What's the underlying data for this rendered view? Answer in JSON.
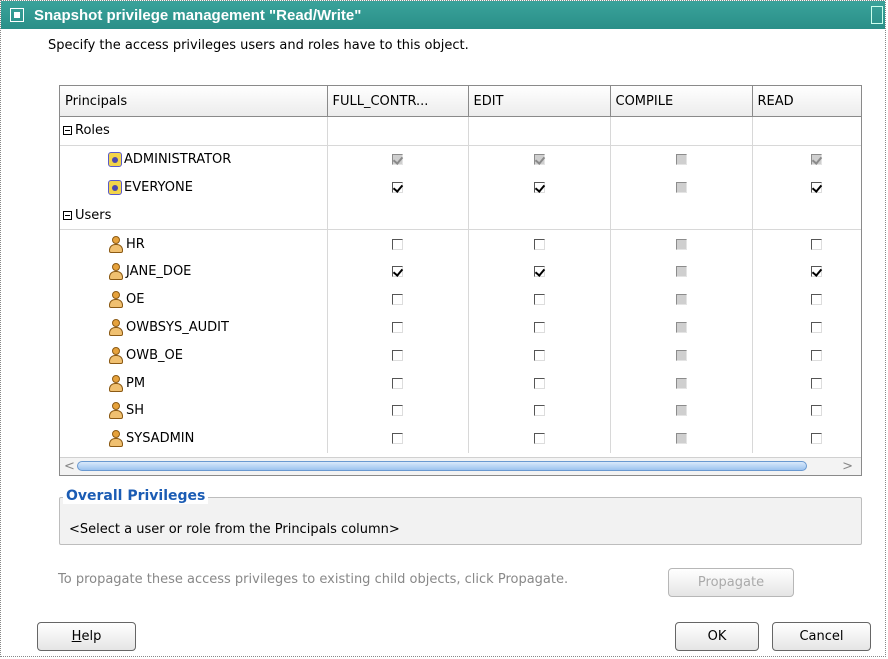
{
  "dialog": {
    "title": "Snapshot privilege management \"Read/Write\"",
    "instructions": "Specify the access privileges users and roles have to this object."
  },
  "table": {
    "columns": [
      "Principals",
      "FULL_CONTR...",
      "EDIT",
      "COMPILE",
      "READ"
    ],
    "groups": [
      {
        "label": "Roles",
        "type": "role",
        "rows": [
          {
            "name": "ADMINISTRATOR",
            "full_control": {
              "checked": true,
              "enabled": false
            },
            "edit": {
              "checked": true,
              "enabled": false
            },
            "compile": {
              "checked": false,
              "enabled": false
            },
            "read": {
              "checked": true,
              "enabled": false
            }
          },
          {
            "name": "EVERYONE",
            "full_control": {
              "checked": true,
              "enabled": true
            },
            "edit": {
              "checked": true,
              "enabled": true
            },
            "compile": {
              "checked": false,
              "enabled": false
            },
            "read": {
              "checked": true,
              "enabled": true
            }
          }
        ]
      },
      {
        "label": "Users",
        "type": "user",
        "rows": [
          {
            "name": "HR",
            "full_control": {
              "checked": false,
              "enabled": true
            },
            "edit": {
              "checked": false,
              "enabled": true
            },
            "compile": {
              "checked": false,
              "enabled": false
            },
            "read": {
              "checked": false,
              "enabled": true
            }
          },
          {
            "name": "JANE_DOE",
            "full_control": {
              "checked": true,
              "enabled": true
            },
            "edit": {
              "checked": true,
              "enabled": true
            },
            "compile": {
              "checked": false,
              "enabled": false
            },
            "read": {
              "checked": true,
              "enabled": true
            }
          },
          {
            "name": "OE",
            "full_control": {
              "checked": false,
              "enabled": true
            },
            "edit": {
              "checked": false,
              "enabled": true
            },
            "compile": {
              "checked": false,
              "enabled": false
            },
            "read": {
              "checked": false,
              "enabled": true
            }
          },
          {
            "name": "OWBSYS_AUDIT",
            "full_control": {
              "checked": false,
              "enabled": true
            },
            "edit": {
              "checked": false,
              "enabled": true
            },
            "compile": {
              "checked": false,
              "enabled": false
            },
            "read": {
              "checked": false,
              "enabled": true
            }
          },
          {
            "name": "OWB_OE",
            "full_control": {
              "checked": false,
              "enabled": true
            },
            "edit": {
              "checked": false,
              "enabled": true
            },
            "compile": {
              "checked": false,
              "enabled": false
            },
            "read": {
              "checked": false,
              "enabled": true
            }
          },
          {
            "name": "PM",
            "full_control": {
              "checked": false,
              "enabled": true
            },
            "edit": {
              "checked": false,
              "enabled": true
            },
            "compile": {
              "checked": false,
              "enabled": false
            },
            "read": {
              "checked": false,
              "enabled": true
            }
          },
          {
            "name": "SH",
            "full_control": {
              "checked": false,
              "enabled": true
            },
            "edit": {
              "checked": false,
              "enabled": true
            },
            "compile": {
              "checked": false,
              "enabled": false
            },
            "read": {
              "checked": false,
              "enabled": true
            }
          },
          {
            "name": "SYSADMIN",
            "full_control": {
              "checked": false,
              "enabled": true
            },
            "edit": {
              "checked": false,
              "enabled": true
            },
            "compile": {
              "checked": false,
              "enabled": false
            },
            "read": {
              "checked": false,
              "enabled": true
            }
          }
        ]
      }
    ]
  },
  "overall": {
    "title": "Overall Privileges",
    "message": "<Select a user or role from the Principals column>"
  },
  "propagate": {
    "text": "To propagate these access privileges to existing child objects, click Propagate.",
    "button_label": "Propagate"
  },
  "buttons": {
    "help_first": "H",
    "help_rest": "elp",
    "ok": "OK",
    "cancel": "Cancel"
  },
  "colors": {
    "titlebar": "#2a8f88",
    "section_title": "#1b5cb4"
  }
}
